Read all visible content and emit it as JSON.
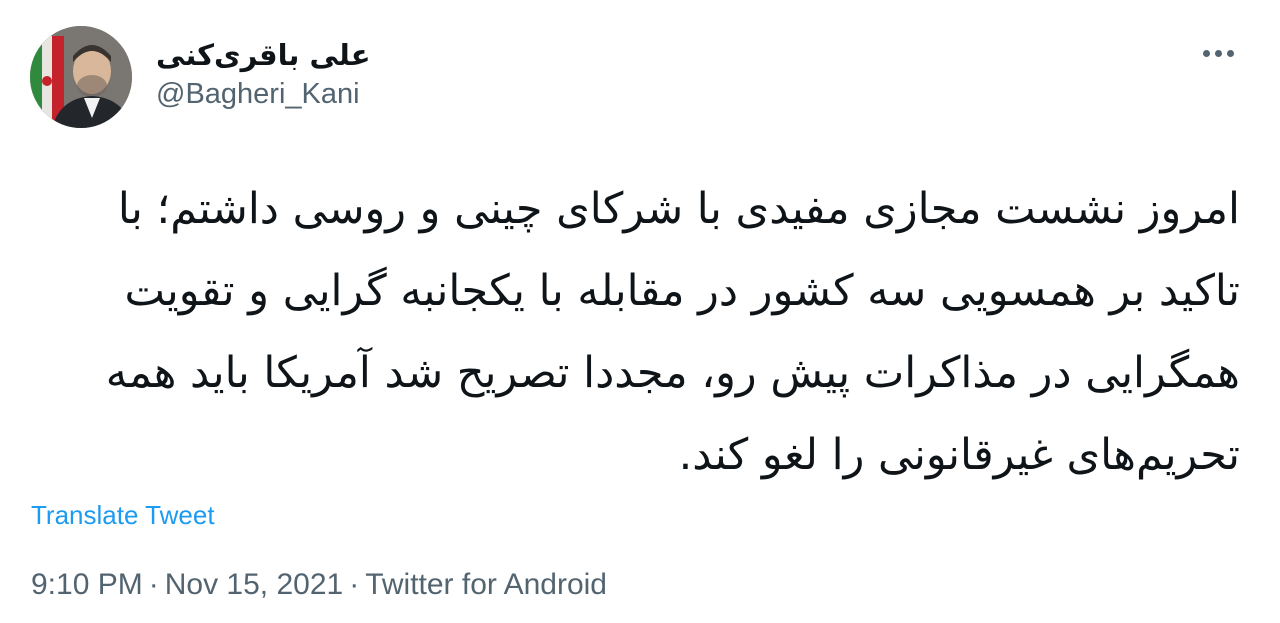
{
  "tweet": {
    "author": {
      "display_name": "علی باقری‌کنی",
      "handle": "@Bagheri_Kani"
    },
    "text": "امروز نشست مجازی مفیدی با شرکای چینی و روسی داشتم؛ با تاکید بر همسویی سه کشور در مقابله با یکجانبه گرایی و تقویت همگرایی در مذاکرات پیش رو، مجددا تصریح شد آمریکا باید همه تحریم‌های غیرقانونی را لغو کند.",
    "translate_label": "Translate Tweet",
    "time": "9:10 PM",
    "date": "Nov 15, 2021",
    "source": "Twitter for Android",
    "separator": "·",
    "more_icon": "more-horizontal-icon"
  },
  "colors": {
    "text_primary": "#0f1419",
    "text_secondary": "#536471",
    "link": "#1d9bf0"
  }
}
